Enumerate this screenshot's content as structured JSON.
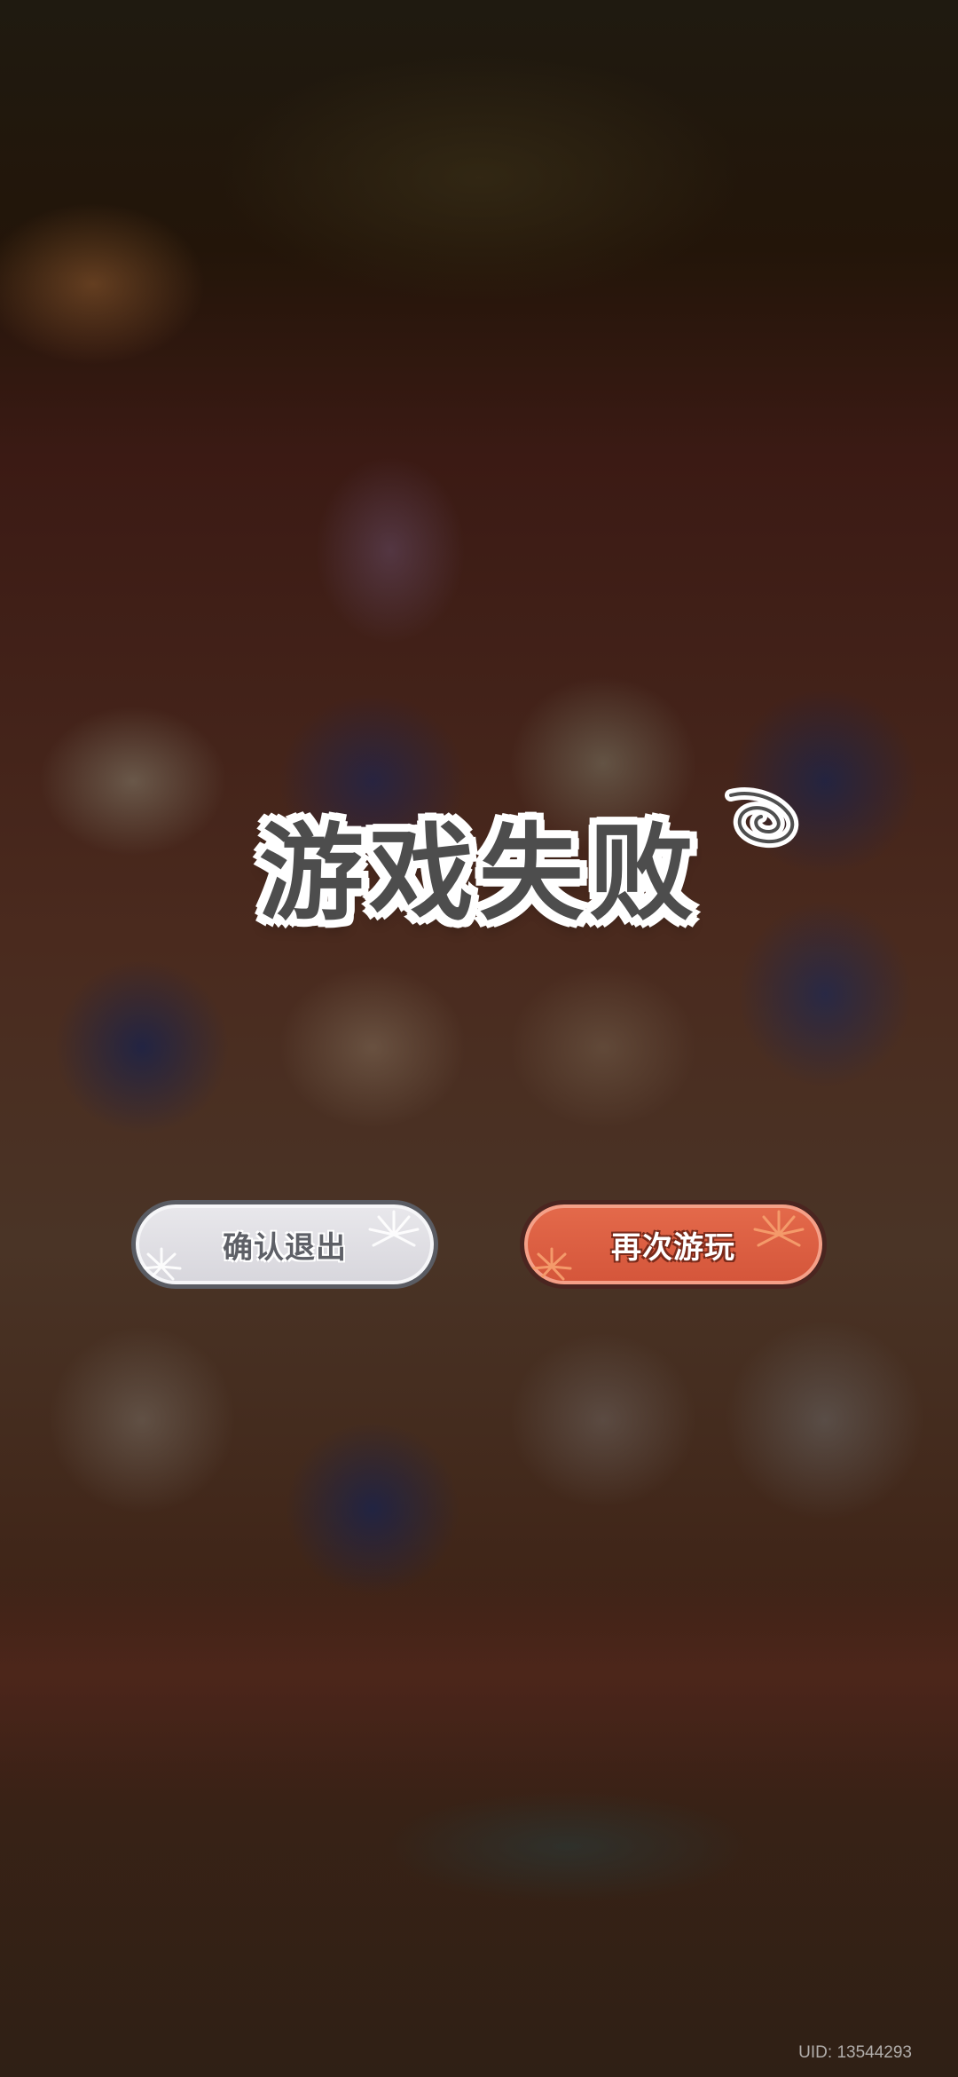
{
  "overlay": {
    "title": "游戏失败",
    "title_color": "#4d4d4d",
    "title_outline_color": "#ffffff",
    "decoration_icon": "scribble-swirl-icon"
  },
  "buttons": {
    "exit": {
      "label": "确认退出",
      "background": "#e2e1e6",
      "border": "#5a5c63",
      "icon": "firework-burst-icon"
    },
    "replay": {
      "label": "再次游玩",
      "background": "#dd5f42",
      "border": "#4a2520",
      "icon": "firework-burst-icon"
    }
  },
  "footer": {
    "uid": "UID: 13544293"
  }
}
